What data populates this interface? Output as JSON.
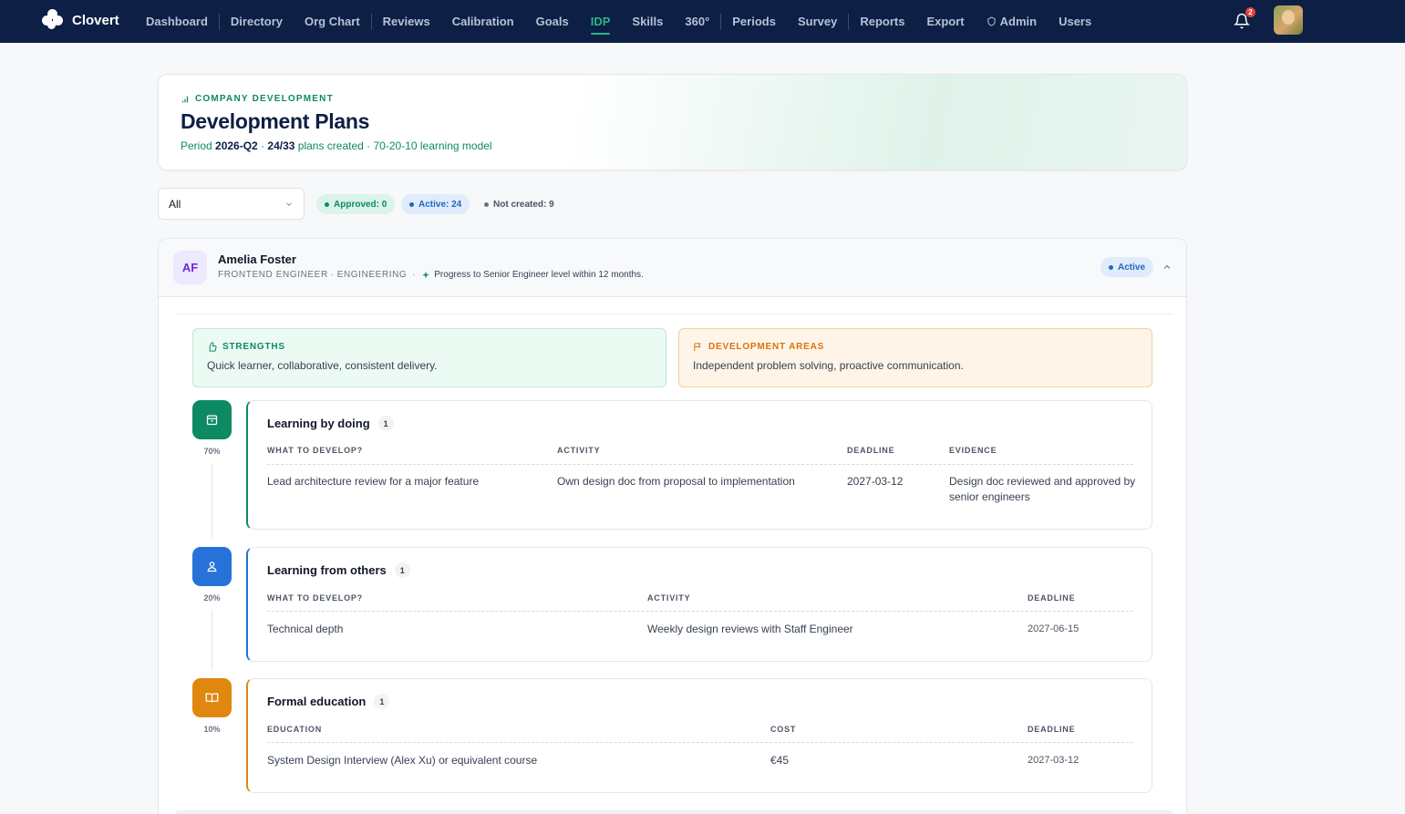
{
  "nav": {
    "brand": "Clovert",
    "items": [
      {
        "label": "Dashboard",
        "active": false
      },
      {
        "label": "Directory",
        "active": false
      },
      {
        "label": "Org Chart",
        "active": false
      },
      {
        "label": "Reviews",
        "active": false
      },
      {
        "label": "Calibration",
        "active": false
      },
      {
        "label": "Goals",
        "active": false
      },
      {
        "label": "IDP",
        "active": true
      },
      {
        "label": "Skills",
        "active": false
      },
      {
        "label": "360°",
        "active": false
      },
      {
        "label": "Periods",
        "active": false
      },
      {
        "label": "Survey",
        "active": false
      },
      {
        "label": "Reports",
        "active": false
      },
      {
        "label": "Export",
        "active": false
      },
      {
        "label": "Admin",
        "active": false
      },
      {
        "label": "Users",
        "active": false
      }
    ],
    "notification_count": "2",
    "accent_color": "#2bb58a",
    "bg_color": "#0d1f45"
  },
  "hero": {
    "eyebrow": "COMPANY DEVELOPMENT",
    "title": "Development Plans",
    "period_label": "Period",
    "period": "2026-Q2",
    "plans_count": "24/33",
    "plans_label": "plans created",
    "model": "70-20-10 learning model"
  },
  "filters": {
    "select_value": "All",
    "approved": "Approved: 0",
    "active": "Active: 24",
    "not_created": "Not created: 9"
  },
  "employee": {
    "initials": "AF",
    "name": "Amelia Foster",
    "role": "FRONTEND ENGINEER",
    "department": "ENGINEERING",
    "goal": "Progress to Senior Engineer level within 12 months.",
    "status": "Active",
    "strengths": {
      "title": "STRENGTHS",
      "text": "Quick learner, collaborative, consistent delivery."
    },
    "development_areas": {
      "title": "DEVELOPMENT AREAS",
      "text": "Independent problem solving, proactive communication."
    }
  },
  "sections": {
    "doing": {
      "percent": "70%",
      "title": "Learning by doing",
      "count": "1",
      "headers": [
        "WHAT TO DEVELOP?",
        "ACTIVITY",
        "DEADLINE",
        "EVIDENCE"
      ],
      "row": {
        "what": "Lead architecture review for a major feature",
        "activity": "Own design doc from proposal to implementation",
        "deadline": "2027-03-12",
        "evidence": "Design doc reviewed and approved by senior engineers"
      },
      "color": "#0d8a63"
    },
    "others": {
      "percent": "20%",
      "title": "Learning from others",
      "count": "1",
      "headers": [
        "WHAT TO DEVELOP?",
        "ACTIVITY",
        "DEADLINE"
      ],
      "row": {
        "what": "Technical depth",
        "activity": "Weekly design reviews with Staff Engineer",
        "deadline": "2027-06-15"
      },
      "color": "#2672d9"
    },
    "formal": {
      "percent": "10%",
      "title": "Formal education",
      "count": "1",
      "headers": [
        "EDUCATION",
        "COST",
        "DEADLINE"
      ],
      "row": {
        "education": "System Design Interview (Alex Xu) or equivalent course",
        "cost": "€45",
        "deadline": "2027-03-12"
      },
      "color": "#e0870f"
    }
  }
}
